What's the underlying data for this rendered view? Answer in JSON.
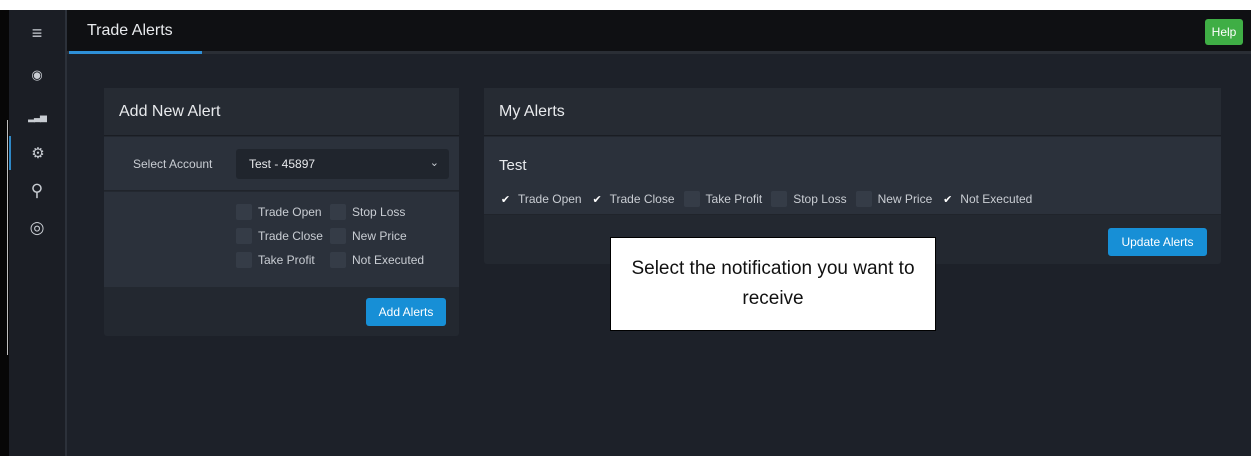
{
  "header": {
    "title": "Trade Alerts",
    "help_label": "Help"
  },
  "sidebar": {
    "items": [
      {
        "icon": "menu-icon",
        "glyph": "≡"
      },
      {
        "icon": "dashboard-icon",
        "glyph": "◉"
      },
      {
        "icon": "signal-bars-icon",
        "glyph": "▂▃▅"
      },
      {
        "icon": "gears-icon",
        "glyph": "⚙"
      },
      {
        "icon": "search-icon",
        "glyph": "⚲"
      },
      {
        "icon": "lifebuoy-icon",
        "glyph": "◎"
      }
    ]
  },
  "add_alert": {
    "title": "Add New Alert",
    "account_label": "Select Account",
    "account_value": "Test - 45897",
    "options": [
      "Trade Open",
      "Stop Loss",
      "Trade Close",
      "New Price",
      "Take Profit",
      "Not Executed"
    ],
    "button_label": "Add Alerts"
  },
  "my_alerts": {
    "title": "My Alerts",
    "account_name": "Test",
    "options": [
      {
        "label": "Trade Open",
        "checked": true
      },
      {
        "label": "Trade Close",
        "checked": true
      },
      {
        "label": "Take Profit",
        "checked": false
      },
      {
        "label": "Stop Loss",
        "checked": false
      },
      {
        "label": "New Price",
        "checked": false
      },
      {
        "label": "Not Executed",
        "checked": true
      }
    ],
    "button_label": "Update Alerts"
  },
  "callout": {
    "text": "Select the notification you want to receive"
  },
  "colors": {
    "accent": "#178fd6",
    "help_green": "#3fae45",
    "background": "#1d2129"
  }
}
